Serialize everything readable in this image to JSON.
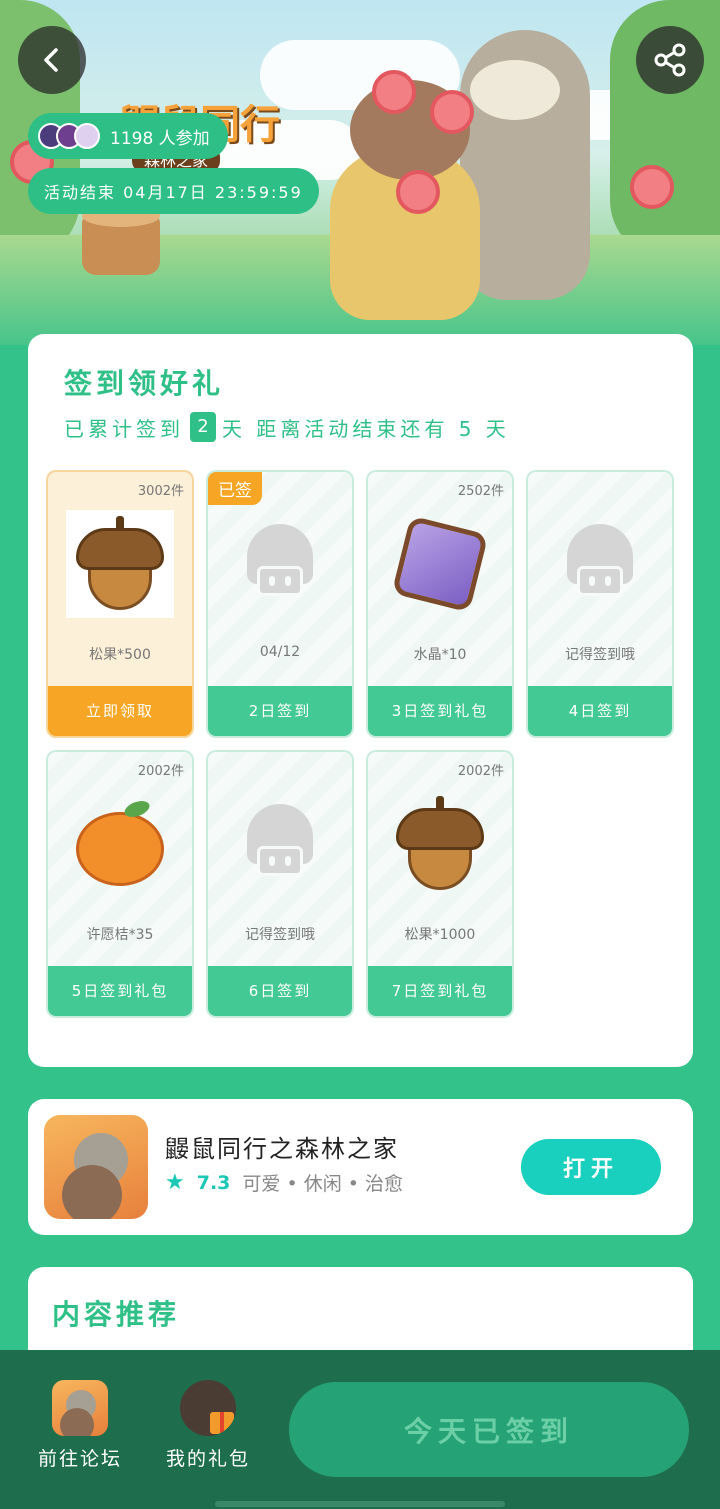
{
  "hero": {
    "title_art": "鼹鼠同行",
    "title_sub": "森林之家",
    "participants_text": "1198 人参加",
    "end_time_text": "活动结束 04月17日 23:59:59"
  },
  "signin": {
    "title": "签到领好礼",
    "stats_prefix": "已累计签到",
    "days_signed": "2",
    "stats_suffix": "天  距离活动结束还有 5 天",
    "tiles": [
      {
        "count": "3002件",
        "item": "松果*500",
        "action": "立即领取",
        "art": "acorn",
        "state": "claim"
      },
      {
        "count": "",
        "item": "04/12",
        "action": "2日签到",
        "art": "ghost",
        "state": "signed",
        "tag": "已签"
      },
      {
        "count": "2502件",
        "item": "水晶*10",
        "action": "3日签到礼包",
        "art": "crystal",
        "state": "normal"
      },
      {
        "count": "",
        "item": "记得签到哦",
        "action": "4日签到",
        "art": "ghost",
        "state": "normal"
      },
      {
        "count": "2002件",
        "item": "许愿桔*35",
        "action": "5日签到礼包",
        "art": "orange",
        "state": "normal"
      },
      {
        "count": "",
        "item": "记得签到哦",
        "action": "6日签到",
        "art": "ghost",
        "state": "normal"
      },
      {
        "count": "2002件",
        "item": "松果*1000",
        "action": "7日签到礼包",
        "art": "acorn",
        "state": "normal"
      }
    ]
  },
  "app": {
    "name": "鼹鼠同行之森林之家",
    "rating": "7.3",
    "tags": "可爱 • 休闲 • 治愈",
    "open_label": "打开"
  },
  "recommend": {
    "title": "内容推荐"
  },
  "bottom": {
    "forum_label": "前往论坛",
    "gift_label": "我的礼包",
    "signed_label": "今天已签到"
  },
  "colors": {
    "brand_green": "#33c38a",
    "claim_orange": "#f6a624",
    "open_teal": "#19cfbd"
  },
  "icons": [
    "back-arrow-icon",
    "share-icon",
    "star-icon"
  ]
}
